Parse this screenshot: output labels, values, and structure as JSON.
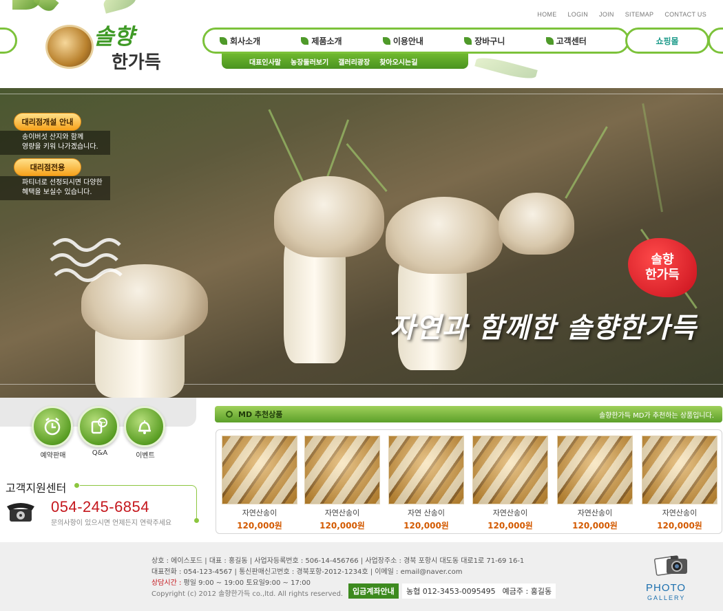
{
  "brand": {
    "line1": "솔향",
    "line2": "한가득"
  },
  "top_menu": [
    "HOME",
    "LOGIN",
    "JOIN",
    "SITEMAP",
    "CONTACT US"
  ],
  "main_nav": [
    "회사소개",
    "제품소개",
    "이용안내",
    "장바구니",
    "고객센터"
  ],
  "shop_nav": "쇼핑몰",
  "sub_nav": [
    "대표인사말",
    "농장둘러보기",
    "갤러리광장",
    "찾아오시는길"
  ],
  "hero": {
    "promo1": {
      "label": "대리점개설 안내",
      "line1": "송이버섯 산지와 함께",
      "line2": "영량을 키워 나가겠습니다."
    },
    "promo2": {
      "label": "대리점전용",
      "line1": "파티너로 선정되시면 다양한",
      "line2": "혜택을 보실수 있습니다."
    },
    "badge_line1": "솔향",
    "badge_line2": "한가득",
    "slogan": "자연과 함께한 솔향한가득"
  },
  "quick_links": [
    "예약판매",
    "Q&A",
    "이벤트"
  ],
  "support": {
    "title": "고객지원센터",
    "phone": "054-245-6854",
    "desc": "문의사항이 있으시면 언제든지 연락주세요"
  },
  "md": {
    "title": "MD 추천상품",
    "subtitle": "솔향한가득 MD가 추천하는 상품입니다.",
    "products": [
      {
        "name": "자연산송이",
        "price": "120,000원"
      },
      {
        "name": "자연산송이",
        "price": "120,000원"
      },
      {
        "name": "자연 산송이",
        "price": "120,000원"
      },
      {
        "name": "자연산송이",
        "price": "120,000원"
      },
      {
        "name": "자연산송이",
        "price": "120,000원"
      },
      {
        "name": "자연산송이",
        "price": "120,000원"
      }
    ]
  },
  "footer": {
    "line1": "상호 : 에이스포드  |  대표 : 홍길동  |  사업자등록번호 : 506-14-456766  |  사업장주소 : 경북 포항시 대도동 대로1로 71-69 16-1",
    "line2": "대표전화 : 054-123-4567  |  통신판매신고번호 : 경북포항-2012-1234호  |  이메일 : email@naver.com",
    "hours_label": "상담시간 :",
    "hours": "평일 9:00 ~ 19:00 토요일9:00 ~ 17:00",
    "copyright": "Copyright (c) 2012 솔향한가득 co.,ltd. All rights reserved.",
    "bank_label": "입금계좌안내",
    "bank_account": "농협 012-3453-0095495",
    "bank_holder": "예금주 : 홍길동",
    "photo": "PHOTO",
    "gallery": "GALLERY"
  },
  "colors": {
    "accent_green": "#7cc23a",
    "price_orange": "#d35a00",
    "phone_red": "#c4161c"
  }
}
